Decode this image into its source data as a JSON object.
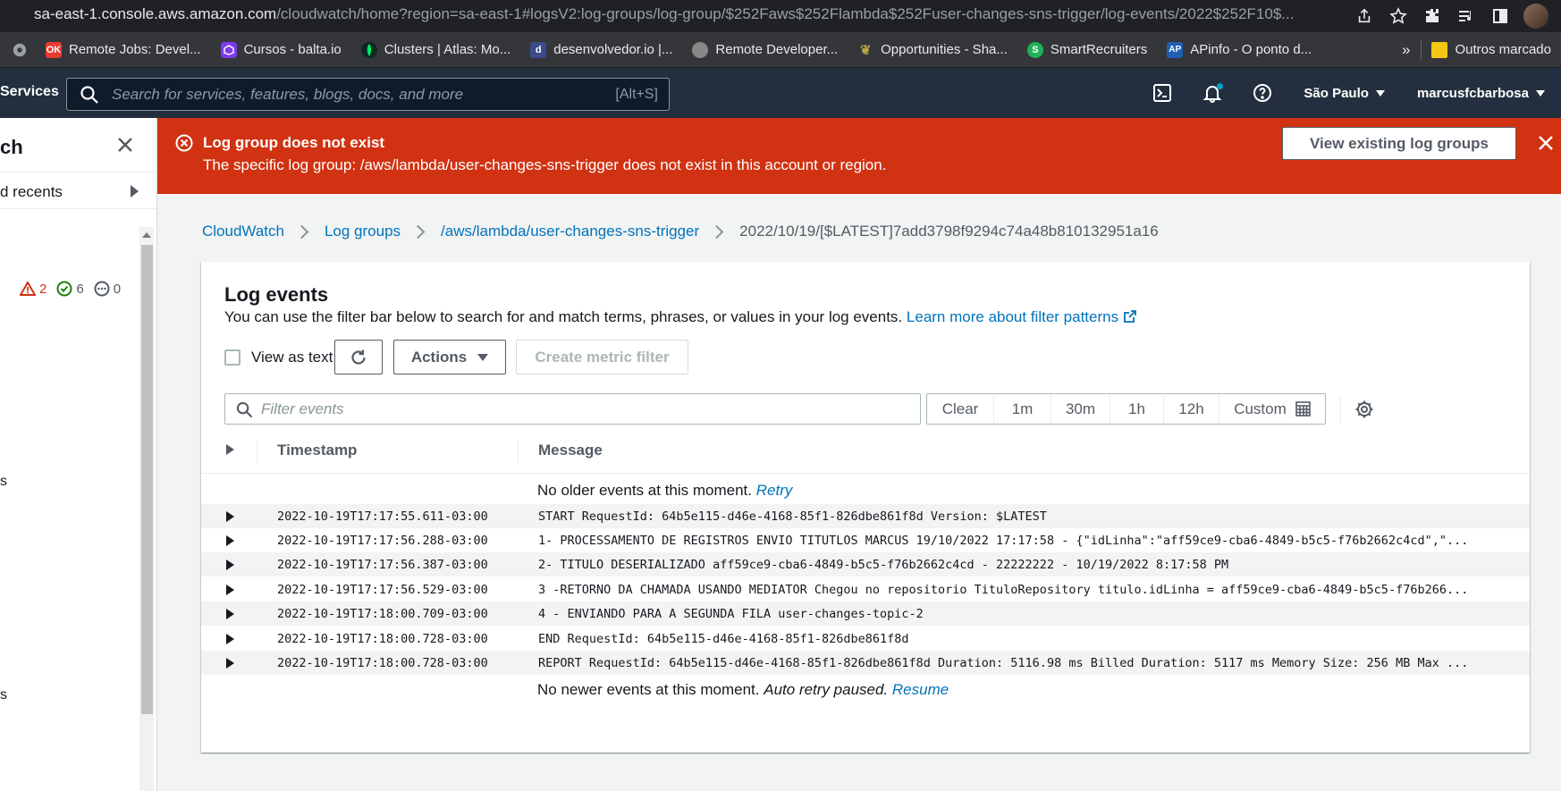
{
  "browser": {
    "url_host": "sa-east-1.console.aws.amazon.com",
    "url_path": "/cloudwatch/home?region=sa-east-1#logsV2:log-groups/log-group/$252Faws$252Flambda$252Fuser-changes-sns-trigger/log-events/2022$252F10$...",
    "bookmarks": [
      {
        "label": "Remote Jobs: Devel...",
        "icon": "ok-icon",
        "color": "#e63b2e"
      },
      {
        "label": "Cursos - balta.io",
        "icon": "balta-icon",
        "color": "#7c3aed"
      },
      {
        "label": "Clusters | Atlas: Mo...",
        "icon": "mongodb-leaf-icon",
        "color": "#00ed64"
      },
      {
        "label": "desenvolvedor.io |...",
        "icon": "d-icon",
        "color": "#3b4a8a"
      },
      {
        "label": "Remote Developer...",
        "icon": "globe-icon",
        "color": "#888888"
      },
      {
        "label": "Opportunities - Sha...",
        "icon": "bird-icon",
        "color": "#b5a642"
      },
      {
        "label": "SmartRecruiters",
        "icon": "s-icon",
        "color": "#1fb25a"
      },
      {
        "label": "APinfo - O ponto d...",
        "icon": "ap-icon",
        "color": "#1e5fb4"
      }
    ],
    "bookmarks_more": "»",
    "other_bookmarks": "Outros marcado"
  },
  "aws_nav": {
    "services": "Services",
    "search_placeholder": "Search for services, features, blogs, docs, and more",
    "search_shortcut": "[Alt+S]",
    "region": "São Paulo",
    "account": "marcusfcbarbosa"
  },
  "sidebar": {
    "title": "ch",
    "recents": "d recents",
    "alarms": {
      "in_alarm": "2",
      "ok": "6",
      "insufficient": "0"
    },
    "fragments": [
      "s",
      "s"
    ]
  },
  "flash": {
    "title": "Log group does not exist",
    "message": "The specific log group: /aws/lambda/user-changes-sns-trigger does not exist in this account or region.",
    "button": "View existing log groups",
    "color": "#d13212"
  },
  "breadcrumb": {
    "items": [
      "CloudWatch",
      "Log groups",
      "/aws/lambda/user-changes-sns-trigger"
    ],
    "current": "2022/10/19/[$LATEST]7add3798f9294c74a48b810132951a16"
  },
  "panel": {
    "title": "Log events",
    "description": "You can use the filter bar below to search for and match terms, phrases, or values in your log events.",
    "learn_more": "Learn more about filter patterns",
    "view_as_text": "View as text",
    "actions": "Actions",
    "create_metric_filter": "Create metric filter",
    "filter_placeholder": "Filter events",
    "time_ranges": [
      "Clear",
      "1m",
      "30m",
      "1h",
      "12h",
      "Custom"
    ]
  },
  "table": {
    "columns": [
      "Timestamp",
      "Message"
    ],
    "older_note": "No older events at this moment.",
    "older_retry": "Retry",
    "newer_note": "No newer events at this moment.",
    "newer_paused": "Auto retry paused.",
    "newer_resume": "Resume",
    "rows": [
      {
        "ts": "2022-10-19T17:17:55.611-03:00",
        "msg": "START RequestId: 64b5e115-d46e-4168-85f1-826dbe861f8d Version: $LATEST"
      },
      {
        "ts": "2022-10-19T17:17:56.288-03:00",
        "msg": "1- PROCESSAMENTO DE REGISTROS ENVIO TITUTLOS MARCUS 19/10/2022 17:17:58 - {\"idLinha\":\"aff59ce9-cba6-4849-b5c5-f76b2662c4cd\",\"..."
      },
      {
        "ts": "2022-10-19T17:17:56.387-03:00",
        "msg": "2- TITULO DESERIALIZADO aff59ce9-cba6-4849-b5c5-f76b2662c4cd - 22222222 - 10/19/2022 8:17:58 PM"
      },
      {
        "ts": "2022-10-19T17:17:56.529-03:00",
        "msg": "3 -RETORNO DA CHAMADA USANDO MEDIATOR Chegou no repositorio TituloRepository titulo.idLinha = aff59ce9-cba6-4849-b5c5-f76b266..."
      },
      {
        "ts": "2022-10-19T17:18:00.709-03:00",
        "msg": "4 - ENVIANDO PARA A SEGUNDA FILA user-changes-topic-2"
      },
      {
        "ts": "2022-10-19T17:18:00.728-03:00",
        "msg": "END RequestId: 64b5e115-d46e-4168-85f1-826dbe861f8d"
      },
      {
        "ts": "2022-10-19T17:18:00.728-03:00",
        "msg": "REPORT RequestId: 64b5e115-d46e-4168-85f1-826dbe861f8d Duration: 5116.98 ms Billed Duration: 5117 ms Memory Size: 256 MB Max ..."
      }
    ]
  }
}
